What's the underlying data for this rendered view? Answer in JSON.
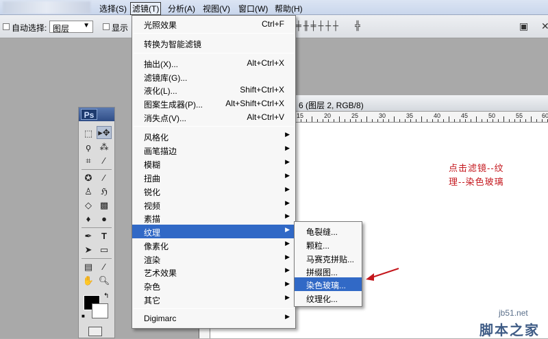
{
  "menubar": {
    "items": [
      {
        "label": "选择(S)"
      },
      {
        "label": "滤镜(T)"
      },
      {
        "label": "分析(A)"
      },
      {
        "label": "视图(V)"
      },
      {
        "label": "窗口(W)"
      },
      {
        "label": "帮助(H)"
      }
    ]
  },
  "optbar": {
    "auto_select_label": "自动选择:",
    "layer_value": "图层",
    "show_label": "显示"
  },
  "filter_menu": {
    "items": [
      {
        "label": "光照效果",
        "shortcut": "Ctrl+F"
      },
      {
        "label": "转换为智能滤镜"
      },
      {
        "label": "抽出(X)...",
        "shortcut": "Alt+Ctrl+X"
      },
      {
        "label": "滤镜库(G)..."
      },
      {
        "label": "液化(L)...",
        "shortcut": "Shift+Ctrl+X"
      },
      {
        "label": "图案生成器(P)...",
        "shortcut": "Alt+Shift+Ctrl+X"
      },
      {
        "label": "消失点(V)...",
        "shortcut": "Alt+Ctrl+V"
      },
      {
        "label": "风格化"
      },
      {
        "label": "画笔描边"
      },
      {
        "label": "模糊"
      },
      {
        "label": "扭曲"
      },
      {
        "label": "锐化"
      },
      {
        "label": "视频"
      },
      {
        "label": "素描"
      },
      {
        "label": "纹理"
      },
      {
        "label": "像素化"
      },
      {
        "label": "渲染"
      },
      {
        "label": "艺术效果"
      },
      {
        "label": "杂色"
      },
      {
        "label": "其它"
      },
      {
        "label": "Digimarc"
      }
    ]
  },
  "texture_submenu": {
    "items": [
      {
        "label": "龟裂缝..."
      },
      {
        "label": "颗粒..."
      },
      {
        "label": "马赛克拼贴..."
      },
      {
        "label": "拼缀图..."
      },
      {
        "label": "染色玻璃..."
      },
      {
        "label": "纹理化..."
      }
    ]
  },
  "document": {
    "title": "6 (图层 2, RGB/8)",
    "ruler_labels": [
      "15",
      "20",
      "25",
      "30",
      "35",
      "40",
      "45",
      "50",
      "55",
      "60"
    ]
  },
  "annotation": {
    "line1": "点击滤镜--纹",
    "line2": "理--染色玻璃"
  },
  "watermark": {
    "url": "jb51.net",
    "brand": "脚本之家"
  },
  "tools": {
    "logo": "Ps"
  },
  "colors": {
    "highlight": "#3169c6",
    "annotation": "#c4161c"
  }
}
